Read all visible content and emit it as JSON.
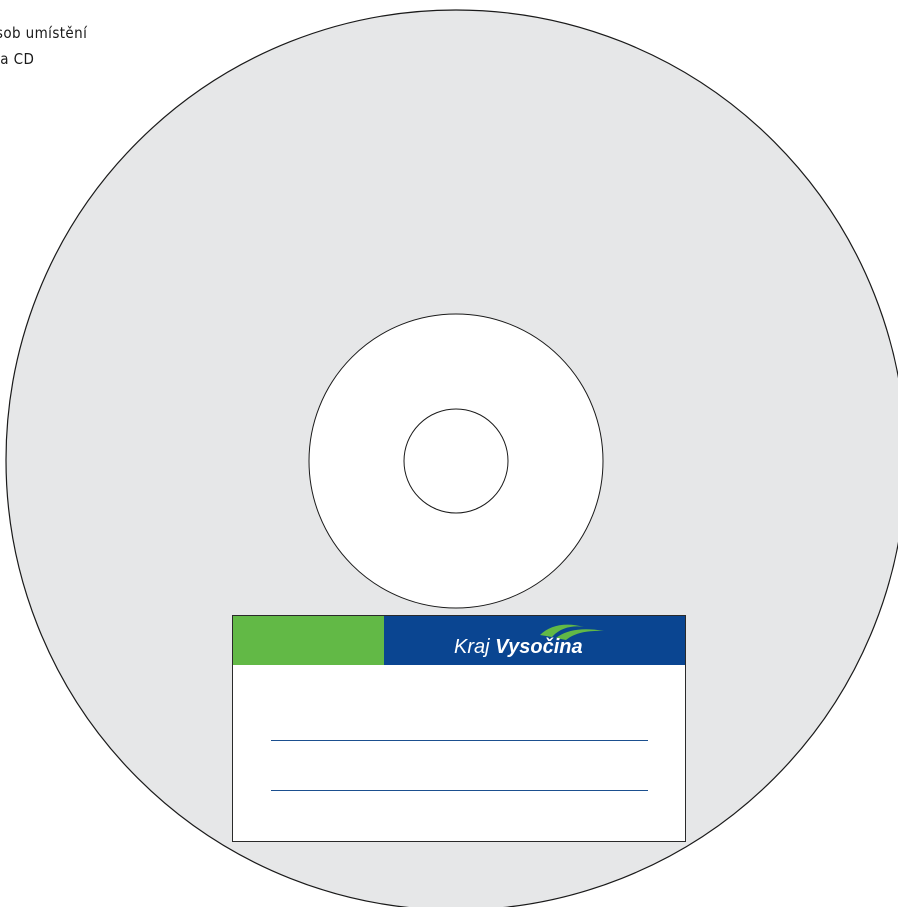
{
  "caption": {
    "line1": "působ umístění",
    "line2": "a na CD"
  },
  "label": {
    "brand_light": "Kraj ",
    "brand_bold": "Vysočina",
    "logo_icon": "kraj-vysocina-swoosh-logo"
  },
  "colors": {
    "disc_fill": "#e6e7e8",
    "disc_outline": "#1a1a1a",
    "hub_fill": "#ffffff",
    "header_green": "#62b946",
    "header_blue": "#0a4591",
    "logo_green": "#62b946",
    "write_line": "#1b4f8f"
  }
}
